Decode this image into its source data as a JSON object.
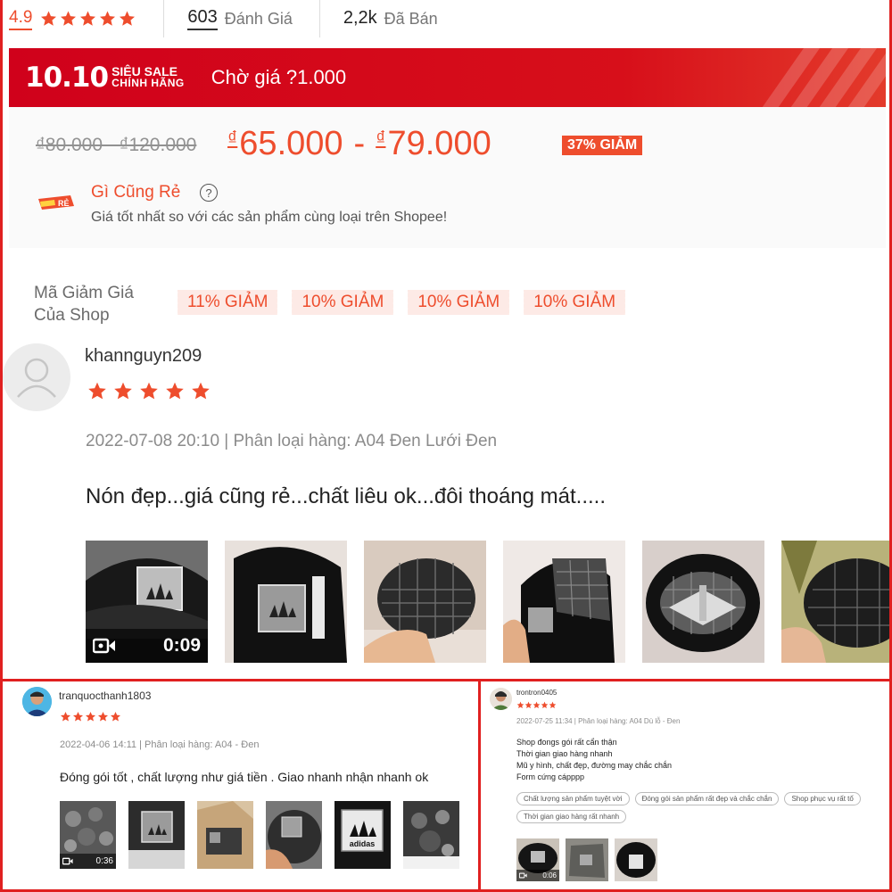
{
  "stats": {
    "rating": "4.9",
    "rating_stars": 5,
    "reviews_count": "603",
    "reviews_label": "Đánh Giá",
    "sold_count": "2,2k",
    "sold_label": "Đã Bán"
  },
  "flash_sale": {
    "event": "10.10",
    "line1": "SIÊU SALE",
    "line2": "CHÍNH HÃNG",
    "wait_text": "Chờ giá ?1.000"
  },
  "price": {
    "original_range": "₫80.000 - ₫120.000",
    "currency": "₫",
    "low": "65.000",
    "separator": "-",
    "high": "79.000",
    "discount": "37% GIẢM"
  },
  "cheap": {
    "logo_text": "RẺ",
    "title": "Gì Cũng Rẻ",
    "help": "?",
    "description": "Giá tốt nhất so với các sản phẩm cùng loại trên Shopee!"
  },
  "vouchers": {
    "label_line1": "Mã Giảm Giá",
    "label_line2": "Của Shop",
    "items": [
      "11% GIẢM",
      "10% GIẢM",
      "10% GIẢM",
      "10% GIẢM"
    ]
  },
  "review_main": {
    "username": "khannguyn209",
    "stars": 5,
    "meta": "2022-07-08 20:10 | Phân loại hàng: A04 Đen Lưới Đen",
    "text": "Nón đẹp...giá cũng rẻ...chất liêu ok...đôi thoáng mát.....",
    "video_duration": "0:09"
  },
  "review_2": {
    "username": "tranquocthanh1803",
    "stars": 5,
    "meta": "2022-04-06 14:11 | Phân loại hàng: A04 - Đen",
    "text": "Đóng gói tốt , chất lượng như giá tiền . Giao nhanh nhận nhanh ok",
    "video_duration": "0:36",
    "logo_text": "adidas"
  },
  "review_3": {
    "username": "trontron0405",
    "stars": 5,
    "meta": "2022-07-25 11:34 | Phân loại hàng: A04 Dù lỗ - Đen",
    "lines": [
      "Shop đongs gói rất cẩn thận",
      "Thời gian giao hàng nhanh",
      "Mũ y hình, chất đẹp, đường may chắc chắn",
      "Form cứng cápppp"
    ],
    "tags": [
      "Chất lượng sản phẩm tuyệt vời",
      "Đóng gói sản phẩm rất đẹp và chắc chắn",
      "Shop phục vụ rất tố",
      "Thời gian giao hàng rất nhanh"
    ],
    "video_duration": "0:06"
  },
  "colors": {
    "accent": "#ee4d2d",
    "banner_red": "#d0011b",
    "border_red": "#e02020",
    "muted_text": "#8b8b8b"
  }
}
